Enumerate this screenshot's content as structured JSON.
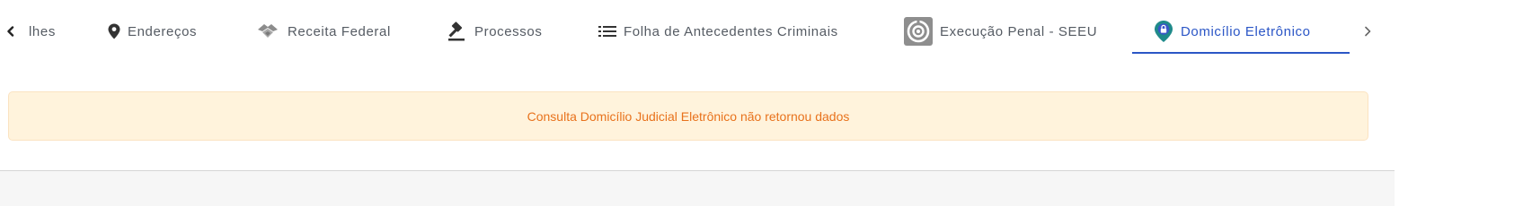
{
  "tabs": [
    {
      "label": "lhes",
      "icon": "chevron-left-icon"
    },
    {
      "label": "Endereços",
      "icon": "map-pin-icon"
    },
    {
      "label": "Receita Federal",
      "icon": "receita-federal-icon"
    },
    {
      "label": "Processos",
      "icon": "gavel-icon"
    },
    {
      "label": "Folha de Antecedentes Criminais",
      "icon": "list-icon"
    },
    {
      "label": "Execução Penal - SEEU",
      "icon": "seeu-icon"
    },
    {
      "label": "Domicílio Eletrônico",
      "icon": "location-lock-icon",
      "active": true
    }
  ],
  "alert": {
    "message": "Consulta Domicílio Judicial Eletrônico não retornou dados"
  },
  "colors": {
    "accent": "#2b56c6",
    "warning_text": "#e8721c",
    "warning_bg": "#fff3dc"
  }
}
